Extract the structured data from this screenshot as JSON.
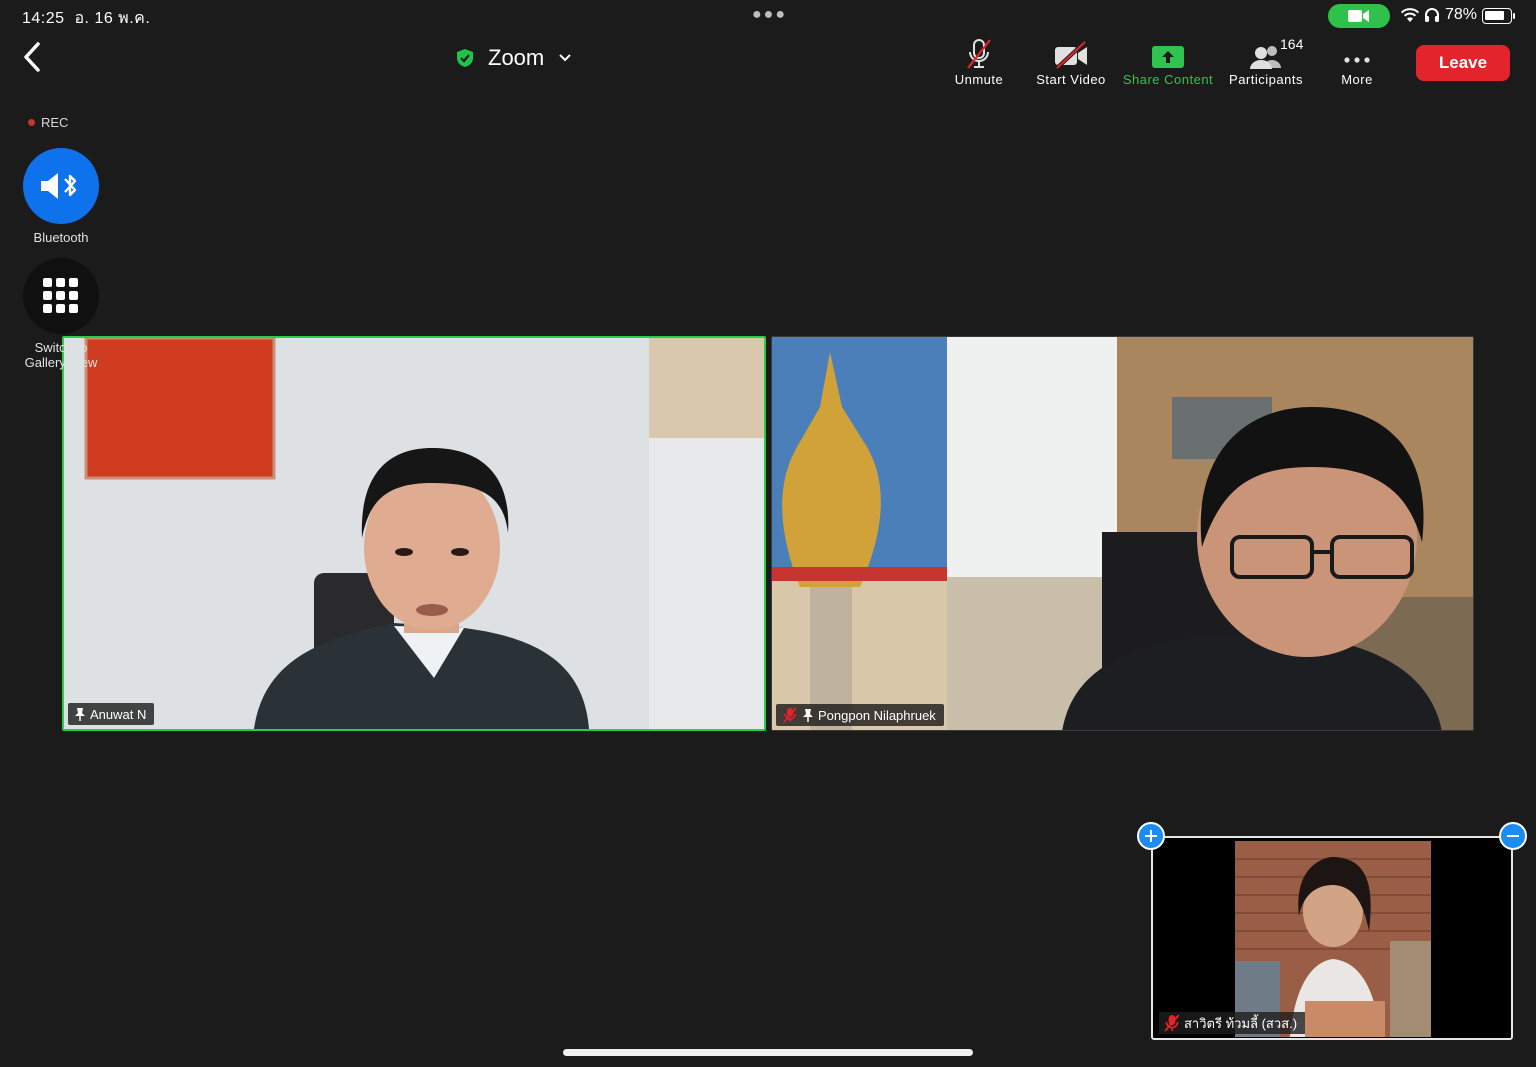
{
  "status_bar": {
    "time": "14:25",
    "date": "อ. 16 พ.ค.",
    "battery_percent": "78%",
    "battery_level": 0.78,
    "camera_indicator_color": "#2fc24b",
    "icons": [
      "video-camera-icon",
      "wifi-icon",
      "headphones-icon",
      "battery-icon"
    ]
  },
  "toolbar": {
    "meeting_title": "Zoom",
    "unmute_label": "Unmute",
    "start_video_label": "Start Video",
    "share_content_label": "Share Content",
    "participants_label": "Participants",
    "participant_count": "164",
    "more_label": "More",
    "leave_label": "Leave",
    "accent_green": "#2ec44f",
    "leave_color": "#e3252b"
  },
  "left_panel": {
    "rec_label": "REC",
    "bluetooth_label": "Bluetooth",
    "gallery_label_line1": "Switch to",
    "gallery_label_line2": "Gallery View",
    "bluetooth_color": "#0e72ed"
  },
  "participants": [
    {
      "name": "Anuwat N",
      "pinned": true,
      "muted": false,
      "active_speaker": true
    },
    {
      "name": "Pongpon Nilaphruek",
      "pinned": true,
      "muted": true,
      "active_speaker": false
    }
  ],
  "self_view": {
    "name": "สาวิตรี ท้วมลี้ (สวส.)",
    "muted": true
  }
}
